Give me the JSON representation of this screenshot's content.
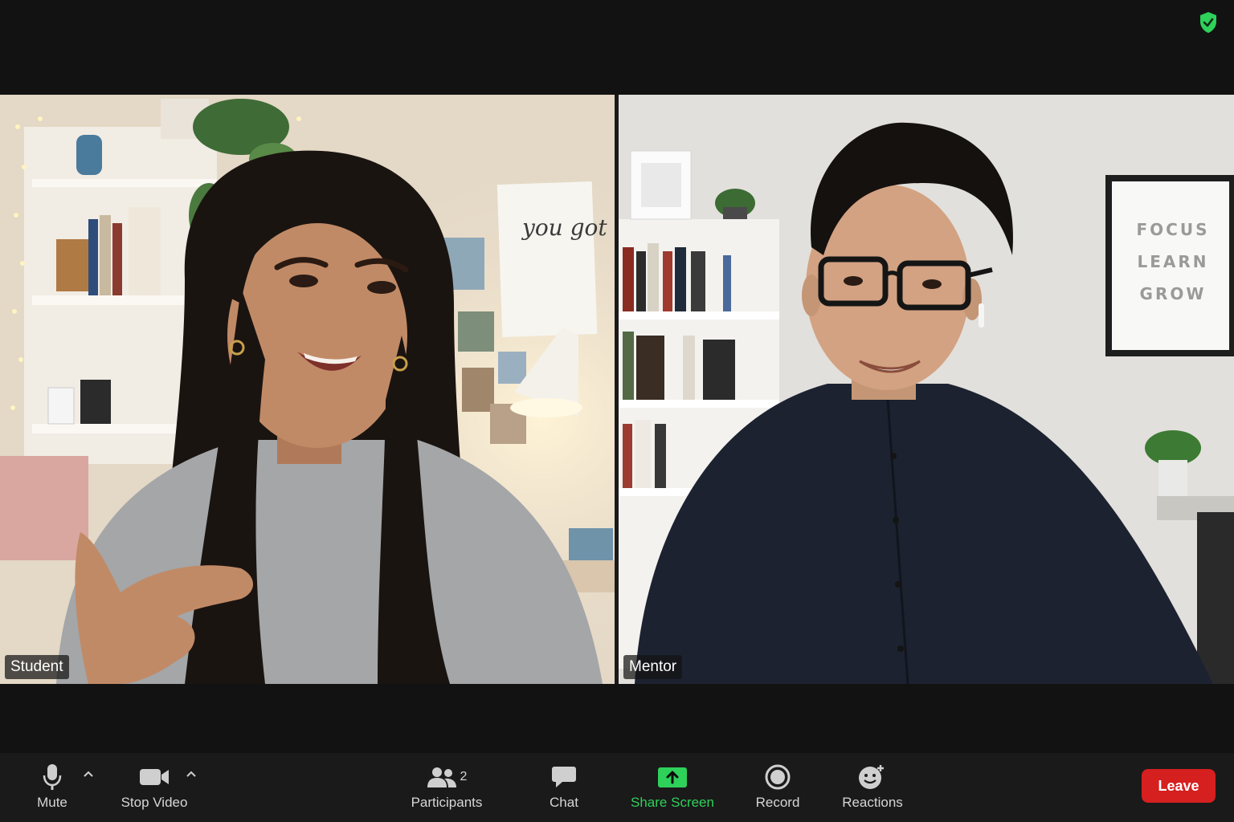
{
  "meeting": {
    "security_icon": "shield-check-icon",
    "security_color": "#2ed15a"
  },
  "participants": [
    {
      "name": "Student"
    },
    {
      "name": "Mentor"
    }
  ],
  "backgrounds": {
    "poster_left": "you got this ♡",
    "poster_right": [
      "FOCUS",
      "LEARN",
      "GROW"
    ]
  },
  "toolbar": {
    "mute": {
      "label": "Mute",
      "icon": "microphone-icon"
    },
    "video": {
      "label": "Stop Video",
      "icon": "video-camera-icon"
    },
    "participants": {
      "label": "Participants",
      "count": "2",
      "icon": "people-icon"
    },
    "chat": {
      "label": "Chat",
      "icon": "chat-bubble-icon"
    },
    "share": {
      "label": "Share Screen",
      "icon": "share-screen-icon",
      "color": "#2ed15a"
    },
    "record": {
      "label": "Record",
      "icon": "record-icon"
    },
    "reactions": {
      "label": "Reactions",
      "icon": "emoji-add-icon"
    },
    "leave": {
      "label": "Leave",
      "color": "#d61f1f"
    }
  }
}
